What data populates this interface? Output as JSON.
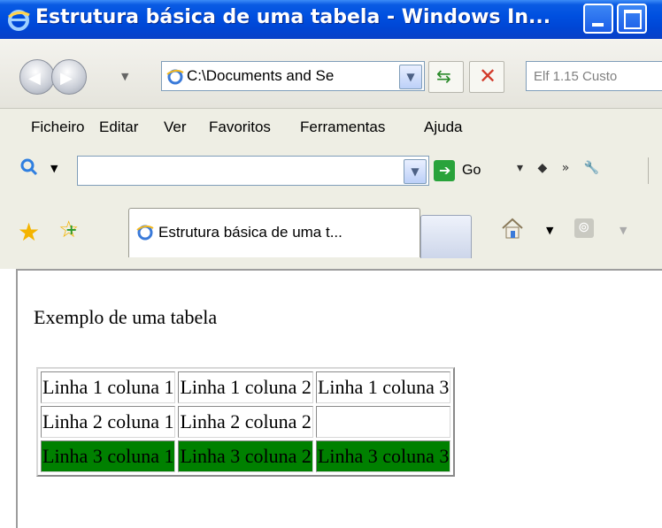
{
  "window": {
    "title": "Estrutura básica de uma tabela - Windows In...",
    "accent": "#0050e0"
  },
  "address_bar": {
    "url": "C:\\Documents and Se",
    "search_placeholder": "Elf 1.15 Custo"
  },
  "menu": {
    "items": [
      "Ficheiro",
      "Editar",
      "Ver",
      "Favoritos",
      "Ferramentas",
      "Ajuda"
    ]
  },
  "search_toolbar": {
    "go_label": "Go",
    "extras": "▾ ◆ » 🔧"
  },
  "tabs": {
    "active_label": "Estrutura básica de uma t..."
  },
  "page": {
    "caption": "Exemplo de uma tabela",
    "table": {
      "rows": [
        {
          "cells": [
            "Linha 1 coluna 1",
            "Linha 1 coluna 2",
            "Linha 1 coluna 3"
          ],
          "highlight": false
        },
        {
          "cells": [
            "Linha 2 coluna 1",
            "Linha 2 coluna 2",
            ""
          ],
          "highlight": false
        },
        {
          "cells": [
            "Linha 3 coluna 1",
            "Linha 3 coluna 2",
            "Linha 3 coluna 3"
          ],
          "highlight": true
        }
      ],
      "highlight_color": "#008000"
    }
  }
}
